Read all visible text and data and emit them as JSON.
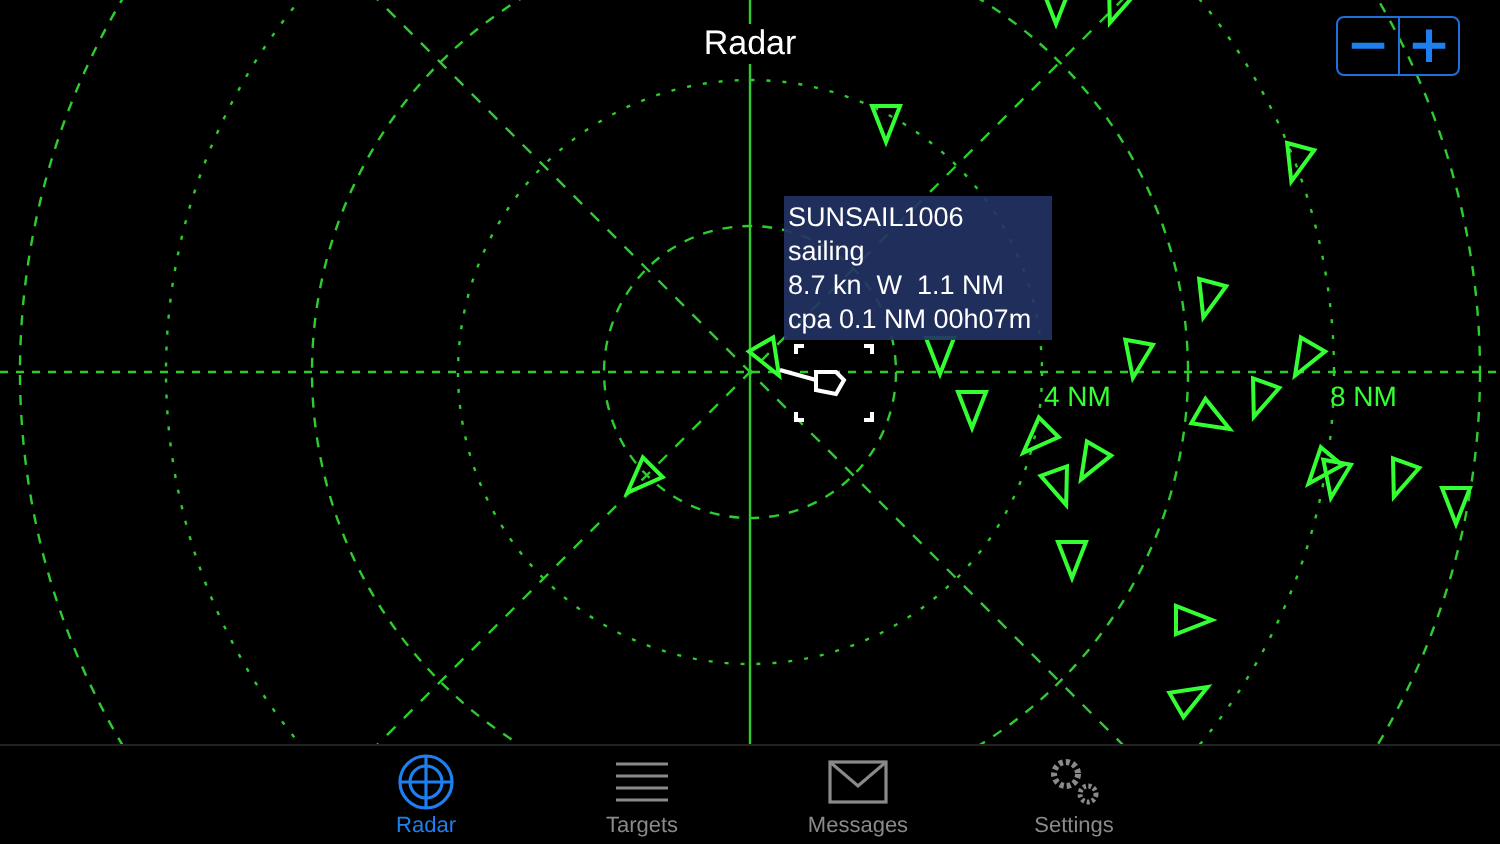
{
  "title": "Radar",
  "zoom_controls": {
    "zoom_out": "−",
    "zoom_in": "+"
  },
  "range_labels": [
    "4 NM",
    "8 NM"
  ],
  "target_info": {
    "name": "SUNSAIL1006",
    "status": "sailing",
    "motion": "8.7 kn  W  1.1 NM",
    "cpa": "cpa 0.1 NM 00h07m"
  },
  "tabs": [
    {
      "label": "Radar",
      "kind": "radar",
      "selected": true
    },
    {
      "label": "Targets",
      "kind": "targets",
      "selected": false
    },
    {
      "label": "Messages",
      "kind": "messages",
      "selected": false
    },
    {
      "label": "Settings",
      "kind": "settings",
      "selected": false
    }
  ]
}
